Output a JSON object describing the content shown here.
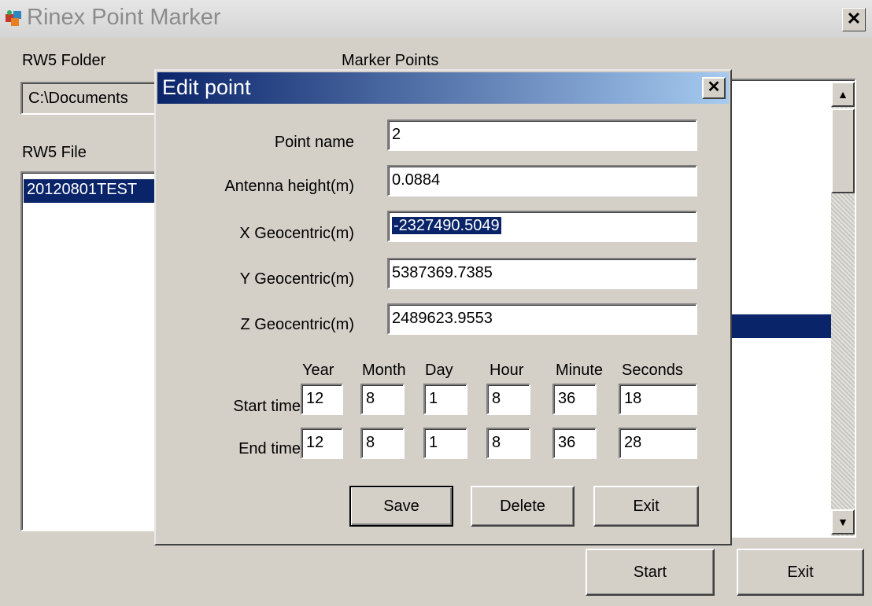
{
  "window": {
    "title": "Rinex Point Marker",
    "close_label": "✕"
  },
  "main": {
    "rw5_folder_label": "RW5 Folder",
    "rw5_folder_value": "C:\\Documents",
    "marker_points_label": "Marker Points",
    "rw5_file_label": "RW5 File",
    "rw5_files": [
      "20120801TEST"
    ],
    "start_label": "Start",
    "exit_label": "Exit"
  },
  "dialog": {
    "title": "Edit point",
    "close_label": "✕",
    "point_name_label": "Point name",
    "point_name_value": "2",
    "antenna_height_label": "Antenna height(m)",
    "antenna_height_value": "0.0884",
    "x_label": "X Geocentric(m)",
    "x_value": "-2327490.5049",
    "y_label": "Y Geocentric(m)",
    "y_value": "5387369.7385",
    "z_label": "Z Geocentric(m)",
    "z_value": "2489623.9553",
    "time_headers": [
      "Year",
      "Month",
      "Day",
      "Hour",
      "Minute",
      "Seconds"
    ],
    "start_time_label": "Start time",
    "start_time": [
      "12",
      "8",
      "1",
      "8",
      "36",
      "18"
    ],
    "end_time_label": "End time",
    "end_time": [
      "12",
      "8",
      "1",
      "8",
      "36",
      "28"
    ],
    "save_label": "Save",
    "delete_label": "Delete",
    "exit_label": "Exit"
  },
  "colors": {
    "window_bg": "#d4d0c8",
    "selection": "#0a246a",
    "titlebar_start": "#0a246a",
    "titlebar_end": "#a6caf0"
  }
}
